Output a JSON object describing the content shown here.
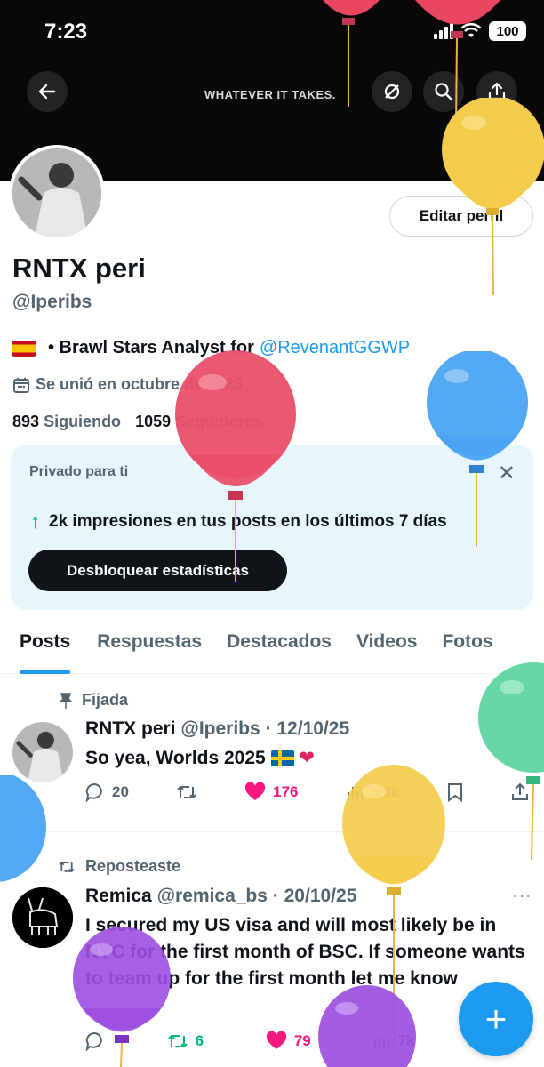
{
  "status_bar": {
    "time": "7:23",
    "battery": "100"
  },
  "banner": {
    "text": "WHATEVER IT TAKES."
  },
  "profile": {
    "edit_label": "Editar perfil",
    "name": "RNTX peri",
    "handle": "@Iperibs",
    "bio_text": "• Brawl Stars Analyst for",
    "bio_link": "@RevenantGGWP",
    "joined": "Se unió en octubre de 2023",
    "following_count": "893",
    "following_label": "Siguiendo",
    "followers_count": "1059",
    "followers_label": "Seguidores"
  },
  "private_card": {
    "title": "Privado para ti",
    "impressions": "2k impresiones en tus posts en los últimos 7 días",
    "button": "Desbloquear estadísticas"
  },
  "tabs": [
    "Posts",
    "Respuestas",
    "Destacados",
    "Videos",
    "Fotos"
  ],
  "tweets": [
    {
      "context": "Fijada",
      "name": "RNTX peri",
      "handle": "@Iperibs",
      "date": "12/10/25",
      "text": "So yea, Worlds 2025",
      "replies": "20",
      "retweets": "",
      "likes": "176",
      "views": "5,8k"
    },
    {
      "context": "Reposteaste",
      "name": "Remica",
      "handle": "@remica_bs",
      "date": "20/10/25",
      "text": "I secured my US visa and will most likely be in NYC for the first month of BSC. If someone wants to team up for the first month let me know",
      "replies": "",
      "retweets": "6",
      "likes": "79",
      "views": "7k"
    }
  ],
  "colors": {
    "accent": "#1d9bf0",
    "like": "#f91880",
    "retweet": "#00ba7c",
    "muted": "#536471"
  }
}
